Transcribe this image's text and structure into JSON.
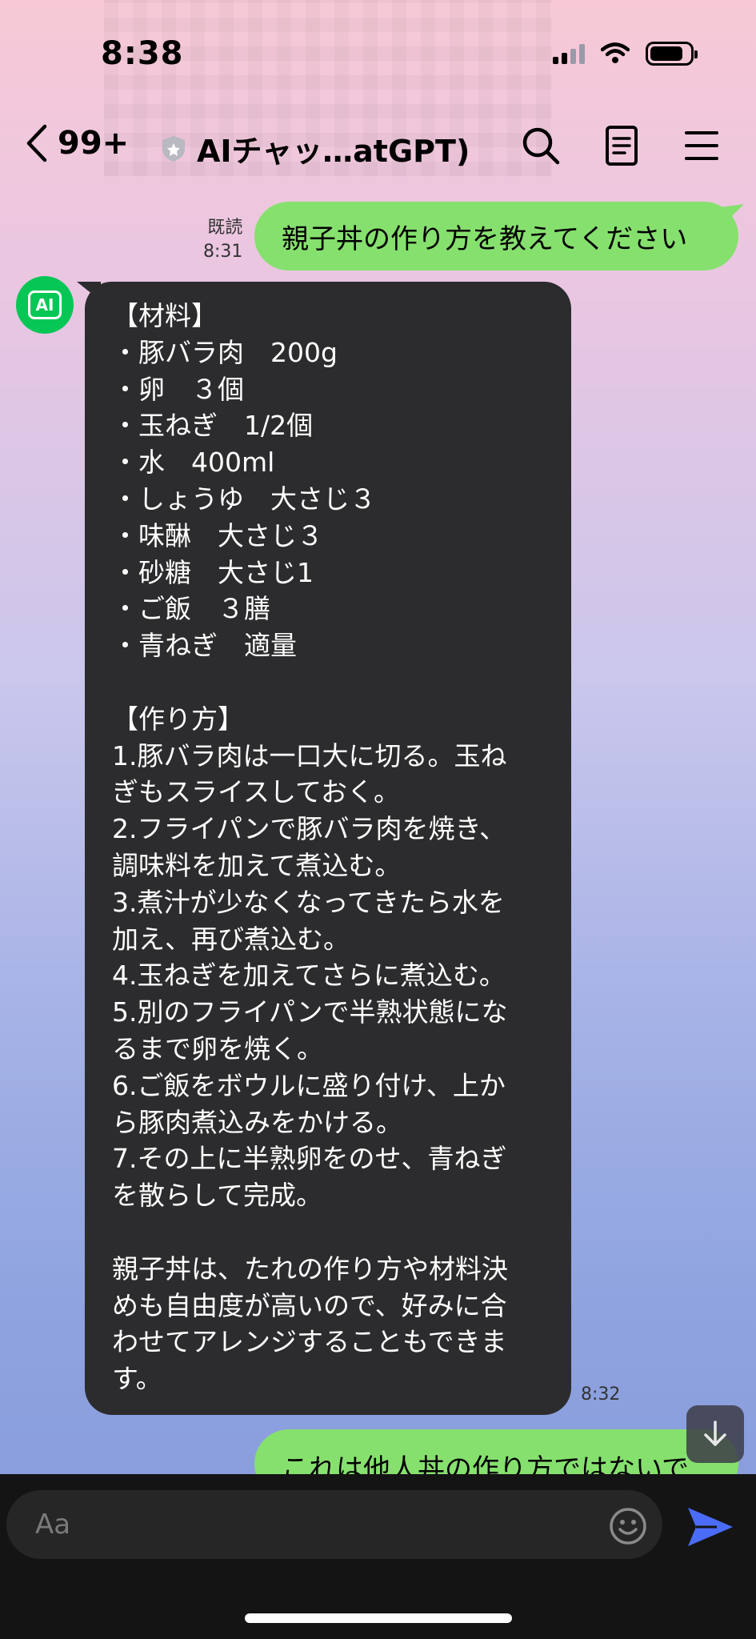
{
  "status_bar": {
    "time": "8:38"
  },
  "header": {
    "back_count": "99+",
    "title": "AIチャッ…atGPT)"
  },
  "messages": {
    "me1": {
      "read_label": "既読",
      "time": "8:31",
      "text": "親子丼の作り方を教えてください"
    },
    "ai": {
      "avatar_text": "AI",
      "time": "8:32",
      "lines": [
        "【材料】",
        "・豚バラ肉　200g",
        "・卵　３個",
        "・玉ねぎ　1/2個",
        "・水　400ml",
        "・しょうゆ　大さじ３",
        "・味醂　大さじ３",
        "・砂糖　大さじ1",
        "・ご飯　３膳",
        "・青ねぎ　適量",
        "",
        "【作り方】",
        "1.豚バラ肉は一口大に切る。玉ね",
        "ぎもスライスしておく。",
        "2.フライパンで豚バラ肉を焼き、",
        "調味料を加えて煮込む。",
        "3.煮汁が少なくなってきたら水を",
        "加え、再び煮込む。",
        "4.玉ねぎを加えてさらに煮込む。",
        "5.別のフライパンで半熟状態にな",
        "るまで卵を焼く。",
        "6.ご飯をボウルに盛り付け、上か",
        "ら豚肉煮込みをかける。",
        "7.その上に半熟卵をのせ、青ねぎ",
        "を散らして完成。",
        "",
        "親子丼は、たれの作り方や材料決",
        "めも自由度が高いので、好みに合",
        "わせてアレンジすることもできま",
        "す。"
      ]
    },
    "me2": {
      "text": "これは他人丼の作り方ではないで"
    }
  },
  "input": {
    "placeholder": "Aa"
  },
  "colors": {
    "bubble_me": "#86e06e",
    "bubble_ai": "#2c2c2e",
    "send_accent": "#4a6cf7",
    "avatar_green": "#06c755"
  }
}
